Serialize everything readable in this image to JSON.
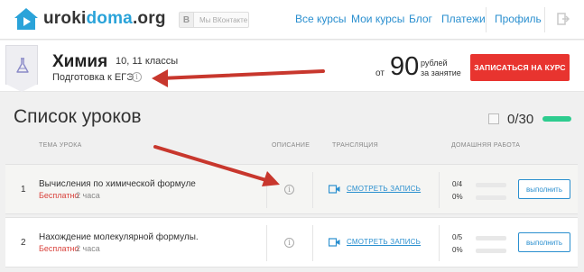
{
  "brand": {
    "logo_part1": "uroki",
    "logo_part2": "doma",
    "logo_part3": ".org",
    "vk_letter": "В",
    "vk_label": "Мы ВКонтакте"
  },
  "nav": {
    "all_courses": "Все курсы",
    "my_courses": "Мои курсы",
    "blog": "Блог",
    "payments": "Платежи",
    "profile": "Профиль"
  },
  "course": {
    "title": "Химия",
    "grades": "10, 11 классы",
    "subtitle": "Подготовка к ЕГЭ",
    "price_from": "от",
    "price_value": "90",
    "price_unit_line1": "рублей",
    "price_unit_line2": "за занятие",
    "enroll_label": "ЗАПИСАТЬСЯ НА КУРС"
  },
  "lessons": {
    "section_title": "Список уроков",
    "progress": "0/30",
    "headers": {
      "topic": "ТЕМА УРОКА",
      "description": "ОПИСАНИЕ",
      "broadcast": "ТРАНСЛЯЦИЯ",
      "homework": "ДОМАШНЯЯ РАБОТА"
    },
    "rows": [
      {
        "num": "1",
        "title": "Вычисления по химической формуле",
        "price": "Бесплатно",
        "duration": "2 часа",
        "watch": "СМОТРЕТЬ ЗАПИСЬ",
        "hw_count": "0/4",
        "hw_percent": "0%",
        "action": "выполнить"
      },
      {
        "num": "2",
        "title": "Нахождение молекулярной формулы.",
        "price": "Бесплатно",
        "duration": "2 часа",
        "watch": "СМОТРЕТЬ ЗАПИСЬ",
        "hw_count": "0/5",
        "hw_percent": "0%",
        "action": "выполнить"
      }
    ]
  },
  "colors": {
    "accent_blue": "#2a8fcf",
    "enroll_red": "#e8342f",
    "progress_green": "#2ecc8f",
    "free_red": "#d9413b",
    "annotation_arrow": "#c8372d"
  },
  "icons": [
    "house-logo-icon",
    "exit-icon",
    "flask-icon",
    "info-icon",
    "book-icon",
    "camera-icon"
  ]
}
